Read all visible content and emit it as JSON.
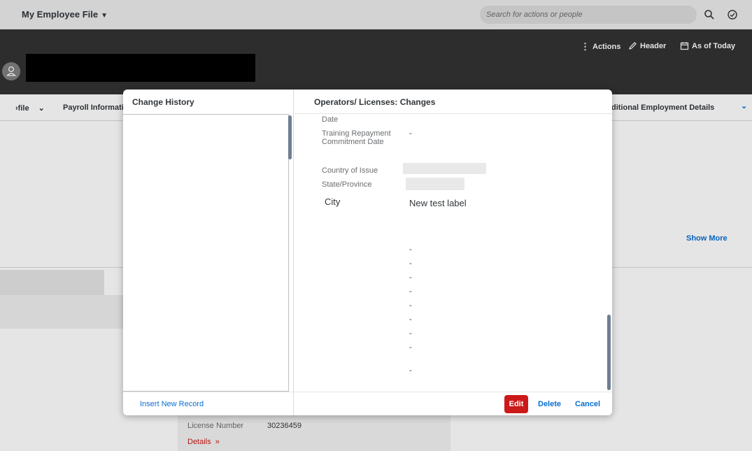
{
  "shell": {
    "app_title": "My Employee File",
    "search_placeholder": "Search for actions or people",
    "icons": [
      "search-icon",
      "check-circle-icon"
    ]
  },
  "header": {
    "actions_label": "Actions",
    "header_label": "Header",
    "as_of_label": "As of Today"
  },
  "tabs": [
    {
      "label": "›file"
    },
    {
      "label": "Payroll Informati"
    },
    {
      "label": "ditional Employment Details"
    }
  ],
  "background": {
    "show_more": "Show More",
    "license_label": "License Number",
    "license_value": "30236459",
    "details_link": "Details"
  },
  "dialog": {
    "left_title": "Change History",
    "right_title": "Operators/ Licenses: Changes",
    "insert_label": "Insert New Record",
    "fields": {
      "date_label": "Date",
      "repay_label": "Training Repayment Commitment Date",
      "repay_value": "-",
      "country_label": "Country of Issue",
      "state_label": "State/Province",
      "city_label": "City",
      "city_value": "New test label"
    },
    "dashes": [
      "-",
      "-",
      "-",
      "-",
      "-",
      "-",
      "-",
      "-",
      "-"
    ],
    "buttons": {
      "edit": "Edit",
      "delete": "Delete",
      "cancel": "Cancel"
    }
  },
  "colors": {
    "accent": "#0a6ed1",
    "edit_button": "#cc1919",
    "header_bg": "#333333"
  }
}
